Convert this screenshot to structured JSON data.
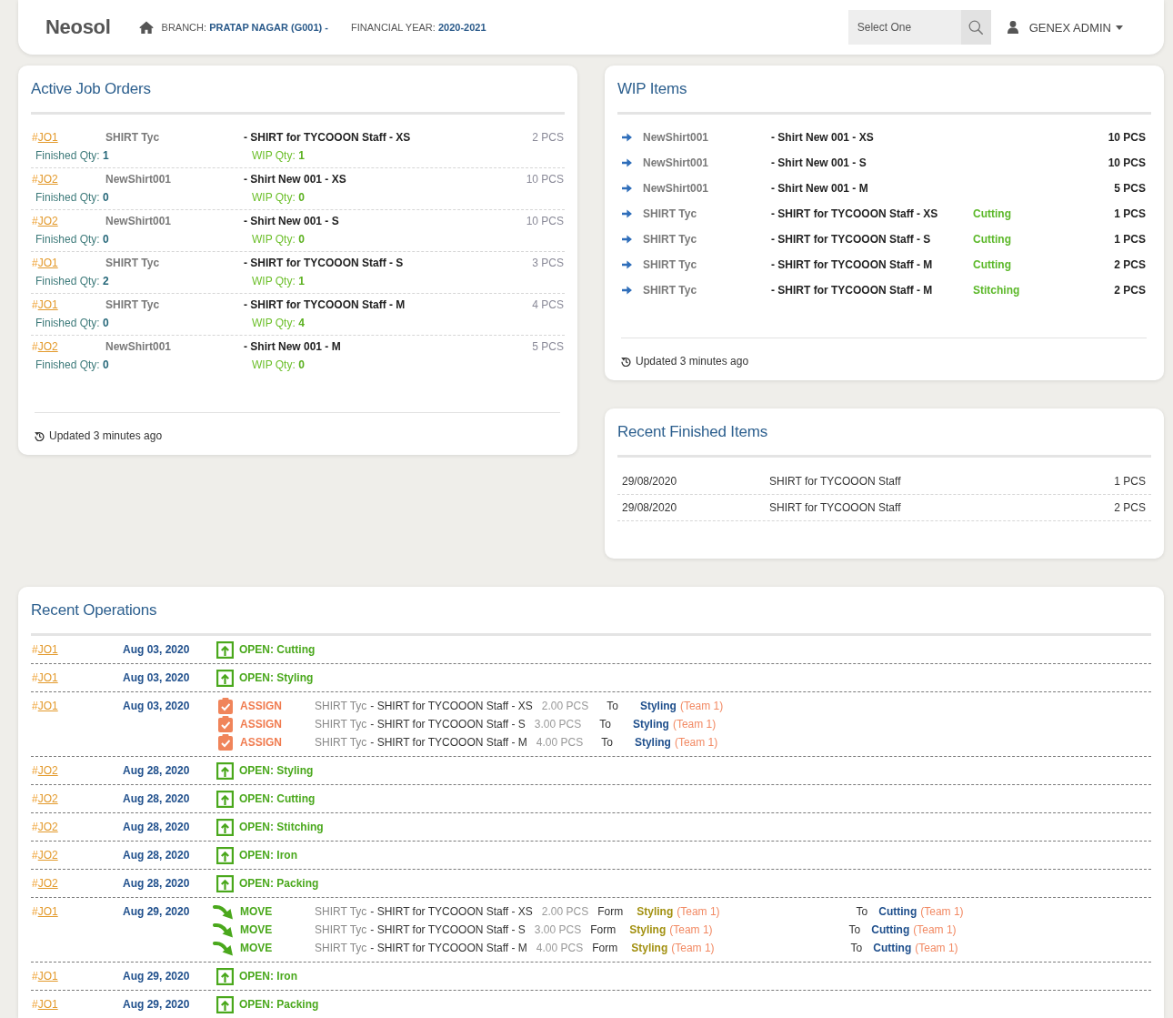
{
  "header": {
    "logo": "Neosol",
    "branch": "BRANCH: **PRATAP NAGAR (G001) -**",
    "financial_year": "FINANCIAL YEAR: **2020-2021**",
    "select": {
      "placeholder": "Select One"
    },
    "user": "GENEX ADMIN"
  },
  "active_job_orders": {
    "title": "Active Job Orders",
    "rows": [
      {
        "prefix": "#",
        "job": "JO1",
        "item": "SHIRT Tyc",
        "description": "- SHIRT for TYCOOON Staff - XS",
        "qty": "2 PCS",
        "finished": "Finished Qty: **1**",
        "wip": "WIP Qty: **1**"
      },
      {
        "prefix": "#",
        "job": "JO2",
        "item": "NewShirt001",
        "description": "- Shirt New 001 - XS",
        "qty": "10 PCS",
        "finished": "Finished Qty: **0**",
        "wip": "WIP Qty: **0**"
      },
      {
        "prefix": "#",
        "job": "JO2",
        "item": "NewShirt001",
        "description": "- Shirt New 001 - S",
        "qty": "10 PCS",
        "finished": "Finished Qty: **0**",
        "wip": "WIP Qty: **0**"
      },
      {
        "prefix": "#",
        "job": "JO1",
        "item": "SHIRT Tyc",
        "description": "- SHIRT for TYCOOON Staff - S",
        "qty": "3 PCS",
        "finished": "Finished Qty: **2**",
        "wip": "WIP Qty: **1**"
      },
      {
        "prefix": "#",
        "job": "JO1",
        "item": "SHIRT Tyc",
        "description": "- SHIRT for TYCOOON Staff - M",
        "qty": "4 PCS",
        "finished": "Finished Qty: **0**",
        "wip": "WIP Qty: **4**"
      },
      {
        "prefix": "#",
        "job": "JO2",
        "item": "NewShirt001",
        "description": "- Shirt New 001 - M",
        "qty": "5 PCS",
        "finished": "Finished Qty: **0**",
        "wip": "WIP Qty: **0**"
      }
    ],
    "updated": "Updated 3 minutes ago"
  },
  "wip_items": {
    "title": "WIP Items",
    "rows": [
      {
        "item": "NewShirt001",
        "description": "- Shirt New 001 - XS",
        "qty": "10 PCS"
      },
      {
        "item": "NewShirt001",
        "description": "- Shirt New 001 - S",
        "qty": "10 PCS"
      },
      {
        "item": "NewShirt001",
        "description": "- Shirt New 001 - M",
        "qty": "5 PCS"
      },
      {
        "item": "SHIRT Tyc",
        "description": "- SHIRT for TYCOOON Staff - XS",
        "stage": "Cutting",
        "qty": "1 PCS"
      },
      {
        "item": "SHIRT Tyc",
        "description": "- SHIRT for TYCOOON Staff - S",
        "stage": "Cutting",
        "qty": "1 PCS"
      },
      {
        "item": "SHIRT Tyc",
        "description": "- SHIRT for TYCOOON Staff - M",
        "stage": "Cutting",
        "qty": "2 PCS"
      },
      {
        "item": "SHIRT Tyc",
        "description": "- SHIRT for TYCOOON Staff - M",
        "stage": "Stitching",
        "qty": "2 PCS"
      }
    ],
    "updated": "Updated 3 minutes ago"
  },
  "recent_finished_items": {
    "title": "Recent Finished Items",
    "rows": [
      {
        "date": "29/08/2020",
        "item": "SHIRT for TYCOOON Staff",
        "qty": "1 PCS"
      },
      {
        "date": "29/08/2020",
        "item": "SHIRT for TYCOOON Staff",
        "qty": "2 PCS"
      }
    ]
  },
  "recent_operations": {
    "title": "Recent Operations",
    "rows": [
      {
        "prefix": "#",
        "job": "JO1",
        "date": "Aug 03, 2020",
        "entries": [
          {
            "kind": "open",
            "action": "OPEN: Cutting"
          }
        ]
      },
      {
        "prefix": "#",
        "job": "JO1",
        "date": "Aug 03, 2020",
        "entries": [
          {
            "kind": "open",
            "action": "OPEN: Styling"
          }
        ]
      },
      {
        "prefix": "#",
        "job": "JO1",
        "date": "Aug 03, 2020",
        "entries": [
          {
            "kind": "assign",
            "action": "ASSIGN",
            "item": "SHIRT Tyc",
            "description": "- SHIRT for TYCOOON Staff - XS",
            "qty": "2.00 PCS",
            "to_label": "To",
            "to_stage": "Styling",
            "to_team": "(Team 1)"
          },
          {
            "kind": "assign",
            "action": "ASSIGN",
            "item": "SHIRT Tyc",
            "description": "- SHIRT for TYCOOON Staff - S",
            "qty": "3.00 PCS",
            "to_label": "To",
            "to_stage": "Styling",
            "to_team": "(Team 1)"
          },
          {
            "kind": "assign",
            "action": "ASSIGN",
            "item": "SHIRT Tyc",
            "description": "- SHIRT for TYCOOON Staff - M",
            "qty": "4.00 PCS",
            "to_label": "To",
            "to_stage": "Styling",
            "to_team": "(Team 1)"
          }
        ]
      },
      {
        "prefix": "#",
        "job": "JO2",
        "date": "Aug 28, 2020",
        "entries": [
          {
            "kind": "open",
            "action": "OPEN: Styling"
          }
        ]
      },
      {
        "prefix": "#",
        "job": "JO2",
        "date": "Aug 28, 2020",
        "entries": [
          {
            "kind": "open",
            "action": "OPEN: Cutting"
          }
        ]
      },
      {
        "prefix": "#",
        "job": "JO2",
        "date": "Aug 28, 2020",
        "entries": [
          {
            "kind": "open",
            "action": "OPEN: Stitching"
          }
        ]
      },
      {
        "prefix": "#",
        "job": "JO2",
        "date": "Aug 28, 2020",
        "entries": [
          {
            "kind": "open",
            "action": "OPEN: Iron"
          }
        ]
      },
      {
        "prefix": "#",
        "job": "JO2",
        "date": "Aug 28, 2020",
        "entries": [
          {
            "kind": "open",
            "action": "OPEN: Packing"
          }
        ]
      },
      {
        "prefix": "#",
        "job": "JO1",
        "date": "Aug 29, 2020",
        "entries": [
          {
            "kind": "move",
            "action": "MOVE",
            "item": "SHIRT Tyc",
            "description": "- SHIRT for TYCOOON Staff - XS",
            "qty": "2.00 PCS",
            "from_label": "Form",
            "from_stage": "Styling",
            "from_team": "(Team 1)",
            "to_label": "To",
            "to_stage": "Cutting",
            "to_team": "(Team 1)"
          },
          {
            "kind": "move",
            "action": "MOVE",
            "item": "SHIRT Tyc",
            "description": "- SHIRT for TYCOOON Staff - S",
            "qty": "3.00 PCS",
            "from_label": "Form",
            "from_stage": "Styling",
            "from_team": "(Team 1)",
            "to_label": "To",
            "to_stage": "Cutting",
            "to_team": "(Team 1)"
          },
          {
            "kind": "move",
            "action": "MOVE",
            "item": "SHIRT Tyc",
            "description": "- SHIRT for TYCOOON Staff - M",
            "qty": "4.00 PCS",
            "from_label": "Form",
            "from_stage": "Styling",
            "from_team": "(Team 1)",
            "to_label": "To",
            "to_stage": "Cutting",
            "to_team": "(Team 1)"
          }
        ]
      },
      {
        "prefix": "#",
        "job": "JO1",
        "date": "Aug 29, 2020",
        "entries": [
          {
            "kind": "open",
            "action": "OPEN: Iron"
          }
        ]
      },
      {
        "prefix": "#",
        "job": "JO1",
        "date": "Aug 29, 2020",
        "entries": [
          {
            "kind": "open",
            "action": "OPEN: Packing"
          }
        ]
      }
    ]
  }
}
